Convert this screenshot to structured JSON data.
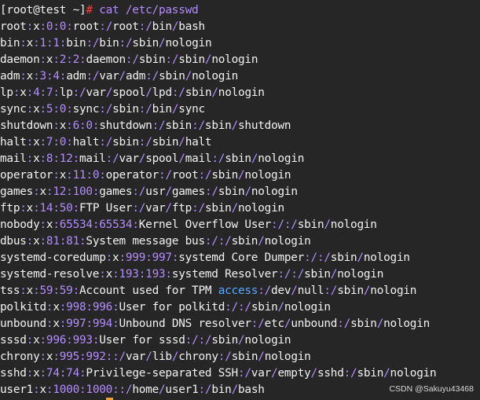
{
  "prompt": {
    "open": "[",
    "user": "root",
    "at": "@",
    "host": "test",
    "path": " ~",
    "close": "]",
    "symbol": "# ",
    "command": "cat /etc/passwd"
  },
  "passwd_lines": [
    [
      "root",
      "x",
      "0",
      "0",
      "root",
      "/root",
      "/bin/bash"
    ],
    [
      "bin",
      "x",
      "1",
      "1",
      "bin",
      "/bin",
      "/sbin/nologin"
    ],
    [
      "daemon",
      "x",
      "2",
      "2",
      "daemon",
      "/sbin",
      "/sbin/nologin"
    ],
    [
      "adm",
      "x",
      "3",
      "4",
      "adm",
      "/var/adm",
      "/sbin/nologin"
    ],
    [
      "lp",
      "x",
      "4",
      "7",
      "lp",
      "/var/spool/lpd",
      "/sbin/nologin"
    ],
    [
      "sync",
      "x",
      "5",
      "0",
      "sync",
      "/sbin",
      "/bin/sync"
    ],
    [
      "shutdown",
      "x",
      "6",
      "0",
      "shutdown",
      "/sbin",
      "/sbin/shutdown"
    ],
    [
      "halt",
      "x",
      "7",
      "0",
      "halt",
      "/sbin",
      "/sbin/halt"
    ],
    [
      "mail",
      "x",
      "8",
      "12",
      "mail",
      "/var/spool/mail",
      "/sbin/nologin"
    ],
    [
      "operator",
      "x",
      "11",
      "0",
      "operator",
      "/root",
      "/sbin/nologin"
    ],
    [
      "games",
      "x",
      "12",
      "100",
      "games",
      "/usr/games",
      "/sbin/nologin"
    ],
    [
      "ftp",
      "x",
      "14",
      "50",
      "FTP User",
      "/var/ftp",
      "/sbin/nologin"
    ],
    [
      "nobody",
      "x",
      "65534",
      "65534",
      "Kernel Overflow User",
      "/",
      "/sbin/nologin"
    ],
    [
      "dbus",
      "x",
      "81",
      "81",
      "System message bus",
      "/",
      "/sbin/nologin"
    ],
    [
      "systemd-coredump",
      "x",
      "999",
      "997",
      "systemd Core Dumper",
      "/",
      "/sbin/nologin"
    ],
    [
      "systemd-resolve",
      "x",
      "193",
      "193",
      "systemd Resolver",
      "/",
      "/sbin/nologin"
    ],
    [
      "tss",
      "x",
      "59",
      "59",
      "Account used for TPM access",
      "/dev/null",
      "/sbin/nologin"
    ],
    [
      "polkitd",
      "x",
      "998",
      "996",
      "User for polkitd",
      "/",
      "/sbin/nologin"
    ],
    [
      "unbound",
      "x",
      "997",
      "994",
      "Unbound DNS resolver",
      "/etc/unbound",
      "/sbin/nologin"
    ],
    [
      "sssd",
      "x",
      "996",
      "993",
      "User for sssd",
      "/",
      "/sbin/nologin"
    ],
    [
      "chrony",
      "x",
      "995",
      "992",
      "",
      "/var/lib/chrony",
      "/sbin/nologin"
    ],
    [
      "sshd",
      "x",
      "74",
      "74",
      "Privilege-separated SSH",
      "/var/empty/sshd",
      "/sbin/nologin"
    ],
    [
      "user1",
      "x",
      "1000",
      "1000",
      "",
      "/home/user1",
      "/bin/bash"
    ]
  ],
  "highlight_word": "access",
  "watermark": "CSDN @Sakuyu43468",
  "colors": {
    "background": "#262626",
    "text": "#f2f2f2",
    "separator": "#b48cff",
    "prompt_hash": "#ff3b3b",
    "keyword": "#5aa9ff",
    "cursor": "#f0a030"
  }
}
